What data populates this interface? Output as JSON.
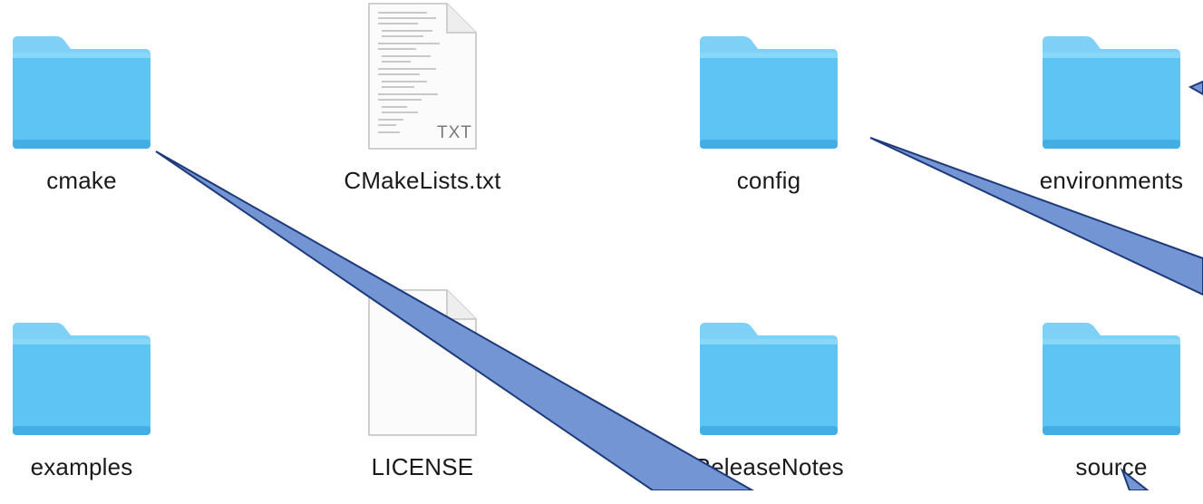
{
  "window": {
    "view_mode": "icon-view"
  },
  "items": [
    {
      "name": "cmake",
      "kind": "folder"
    },
    {
      "name": "CMakeLists.txt",
      "kind": "text-document",
      "badge": "TXT"
    },
    {
      "name": "config",
      "kind": "folder"
    },
    {
      "name": "environments",
      "kind": "folder"
    },
    {
      "name": "examples",
      "kind": "folder"
    },
    {
      "name": "LICENSE",
      "kind": "plain-document"
    },
    {
      "name": "ReleaseNotes",
      "kind": "folder"
    },
    {
      "name": "source",
      "kind": "folder"
    }
  ],
  "colors": {
    "folder_body": "#5ec4f3",
    "folder_tab": "#7fd0f6",
    "folder_edge": "#43aee3",
    "document_fill": "#fbfbfb",
    "document_edge": "#cfcfcf",
    "callout_fill": "#7395d3",
    "callout_stroke": "#1f3a7a",
    "label_text": "#1a1a1a"
  },
  "icons": {
    "folder": "folder-icon",
    "text_document": "text-document-icon",
    "plain_document": "document-icon"
  }
}
